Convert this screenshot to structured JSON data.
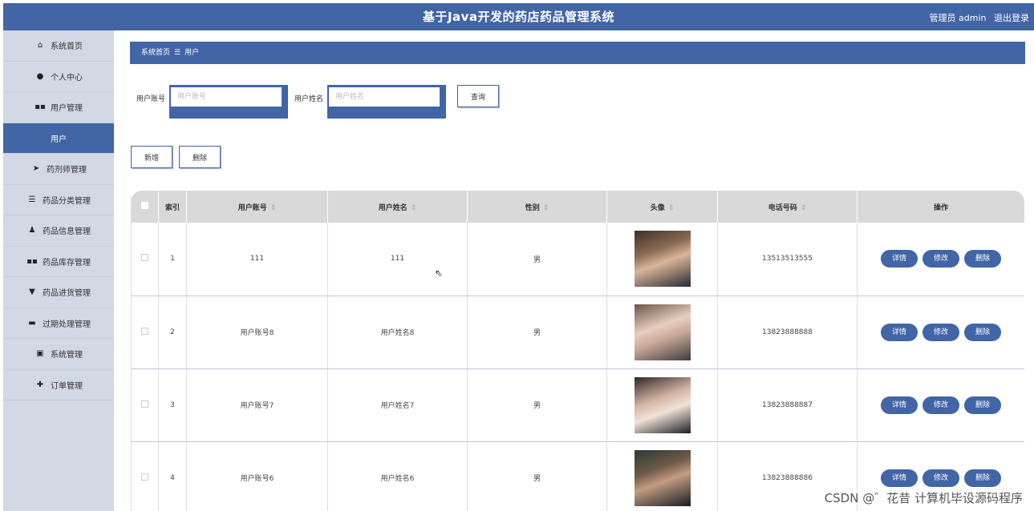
{
  "header": {
    "title": "基于Java开发的药店药品管理系统",
    "role": "管理员 admin",
    "logout": "退出登录"
  },
  "sidebar": {
    "items": [
      {
        "label": "系统首页",
        "icon": "home-icon"
      },
      {
        "label": "个人中心",
        "icon": "user-icon"
      },
      {
        "label": "用户管理",
        "icon": "grid-icon"
      },
      {
        "label": "用户",
        "icon": "",
        "active": true
      },
      {
        "label": "药剂师管理",
        "icon": "send-icon"
      },
      {
        "label": "药品分类管理",
        "icon": "sliders-icon"
      },
      {
        "label": "药品信息管理",
        "icon": "person-icon"
      },
      {
        "label": "药品库存管理",
        "icon": "grid-icon"
      },
      {
        "label": "药品进货管理",
        "icon": "cup-icon"
      },
      {
        "label": "过期处理管理",
        "icon": "monitor-icon"
      },
      {
        "label": "系统管理",
        "icon": "clipboard-icon"
      },
      {
        "label": "订单管理",
        "icon": "thumb-icon"
      }
    ]
  },
  "breadcrumb": {
    "home": "系统首页",
    "sep": "☰",
    "current": "用户"
  },
  "search": {
    "account_label": "用户账号",
    "account_placeholder": "用户账号",
    "name_label": "用户姓名",
    "name_placeholder": "用户姓名",
    "query_button": "查询"
  },
  "actions": {
    "add": "新增",
    "delete": "删除"
  },
  "table": {
    "headers": {
      "index": "索引",
      "account": "用户账号",
      "name": "用户姓名",
      "gender": "性别",
      "avatar": "头像",
      "phone": "电话号码",
      "ops": "操作"
    },
    "sort_glyph": "⇕",
    "rows": [
      {
        "index": "1",
        "account": "111",
        "name": "111",
        "gender": "男",
        "phone": "13513513555"
      },
      {
        "index": "2",
        "account": "用户账号8",
        "name": "用户姓名8",
        "gender": "男",
        "phone": "13823888888"
      },
      {
        "index": "3",
        "account": "用户账号7",
        "name": "用户姓名7",
        "gender": "男",
        "phone": "13823888887"
      },
      {
        "index": "4",
        "account": "用户账号6",
        "name": "用户姓名6",
        "gender": "男",
        "phone": "13823888886"
      }
    ],
    "op_labels": {
      "detail": "详情",
      "edit": "修改",
      "remove": "删除"
    }
  },
  "watermark": "CSDN @゛花昔  计算机毕设源码程序",
  "colors": {
    "primary": "#4265a6",
    "sidebar_bg": "#d2d8e4",
    "header_row": "#d9d9d9"
  }
}
